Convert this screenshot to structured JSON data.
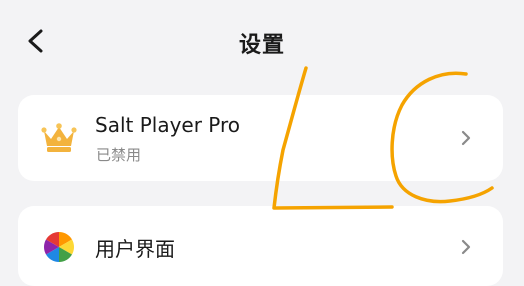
{
  "header": {
    "title": "设置",
    "back_icon": "chevron-left-icon"
  },
  "pro_card": {
    "icon": "crown-icon",
    "title": "Salt Player Pro",
    "subtitle": "已禁用",
    "chevron_icon": "chevron-right-icon"
  },
  "ui_card": {
    "icon": "color-palette-icon",
    "title": "用户界面",
    "chevron_icon": "chevron-right-icon"
  },
  "overlay": {
    "handwriting_color": "#f5a300"
  },
  "colors": {
    "background": "#f3f3f5",
    "card": "#ffffff",
    "crown_gold": "#f3b33d",
    "text_primary": "#1a1a1a",
    "text_secondary": "#8a8a8a",
    "chevron": "#8a8a8a"
  }
}
